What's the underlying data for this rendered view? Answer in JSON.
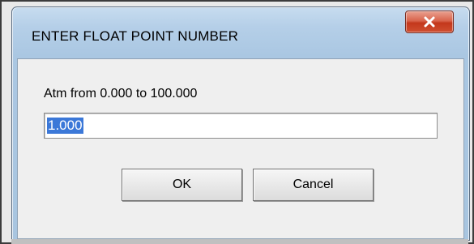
{
  "dialog": {
    "title": "ENTER FLOAT POINT NUMBER",
    "close_icon": "close-icon",
    "prompt": "Atm from 0.000 to 100.000",
    "value": "1.000",
    "buttons": {
      "ok_label": "OK",
      "cancel_label": "Cancel"
    }
  },
  "colors": {
    "titlebar": "#b5cfe8",
    "close_button": "#c4381c",
    "selection": "#3b78d8",
    "client": "#efefef"
  }
}
